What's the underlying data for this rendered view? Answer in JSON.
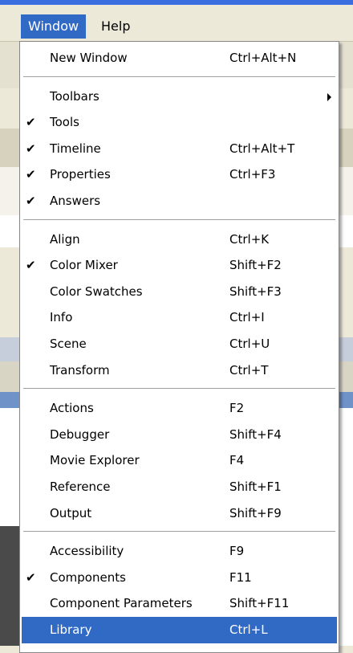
{
  "menubar": {
    "items": [
      {
        "label": "Window"
      },
      {
        "label": "Help"
      }
    ]
  },
  "menu": {
    "groups": [
      [
        {
          "label": "New Window",
          "shortcut": "Ctrl+Alt+N",
          "checked": false
        }
      ],
      [
        {
          "label": "Toolbars",
          "shortcut": "",
          "checked": false,
          "submenu": true
        },
        {
          "label": "Tools",
          "shortcut": "",
          "checked": true
        },
        {
          "label": "Timeline",
          "shortcut": "Ctrl+Alt+T",
          "checked": true
        },
        {
          "label": "Properties",
          "shortcut": "Ctrl+F3",
          "checked": true
        },
        {
          "label": "Answers",
          "shortcut": "",
          "checked": true
        }
      ],
      [
        {
          "label": "Align",
          "shortcut": "Ctrl+K",
          "checked": false
        },
        {
          "label": "Color Mixer",
          "shortcut": "Shift+F2",
          "checked": true
        },
        {
          "label": "Color Swatches",
          "shortcut": "Shift+F3",
          "checked": false
        },
        {
          "label": "Info",
          "shortcut": "Ctrl+I",
          "checked": false
        },
        {
          "label": "Scene",
          "shortcut": "Ctrl+U",
          "checked": false
        },
        {
          "label": "Transform",
          "shortcut": "Ctrl+T",
          "checked": false
        }
      ],
      [
        {
          "label": "Actions",
          "shortcut": "F2",
          "checked": false
        },
        {
          "label": "Debugger",
          "shortcut": "Shift+F4",
          "checked": false
        },
        {
          "label": "Movie Explorer",
          "shortcut": "F4",
          "checked": false
        },
        {
          "label": "Reference",
          "shortcut": "Shift+F1",
          "checked": false
        },
        {
          "label": "Output",
          "shortcut": "Shift+F9",
          "checked": false
        }
      ],
      [
        {
          "label": "Accessibility",
          "shortcut": "F9",
          "checked": false
        },
        {
          "label": "Components",
          "shortcut": "F11",
          "checked": true
        },
        {
          "label": "Component Parameters",
          "shortcut": "Shift+F11",
          "checked": false
        },
        {
          "label": "Library",
          "shortcut": "Ctrl+L",
          "checked": false,
          "selected": true
        }
      ]
    ]
  },
  "colors": {
    "highlight": "#316ac5",
    "menu_background": "#ffffff",
    "chrome": "#ece9d8"
  },
  "icons": {
    "check": "check-mark-icon",
    "submenu": "submenu-arrow-icon"
  }
}
